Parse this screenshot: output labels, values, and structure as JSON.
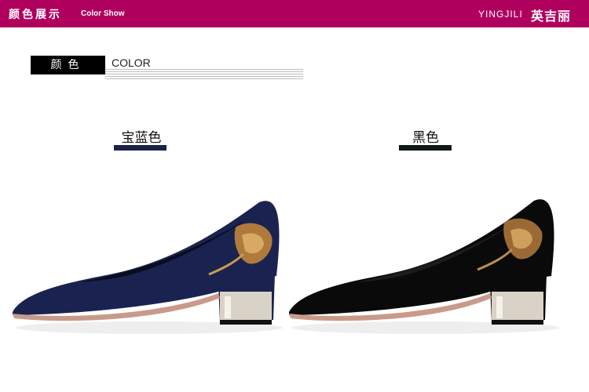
{
  "header": {
    "title_cn": "颜色展示",
    "title_en": "Color Show",
    "brand_en": "YINGJILI",
    "brand_cn": "英吉丽",
    "bar_color": "#b0005e"
  },
  "section": {
    "tag_cn": "颜色",
    "tag_en": "COLOR"
  },
  "colors": [
    {
      "label": "宝蓝色",
      "swatch": "#1b2446",
      "shoe_color": "#1a2350"
    },
    {
      "label": "黑色",
      "swatch": "#101914",
      "shoe_color": "#0a0a0a"
    }
  ]
}
